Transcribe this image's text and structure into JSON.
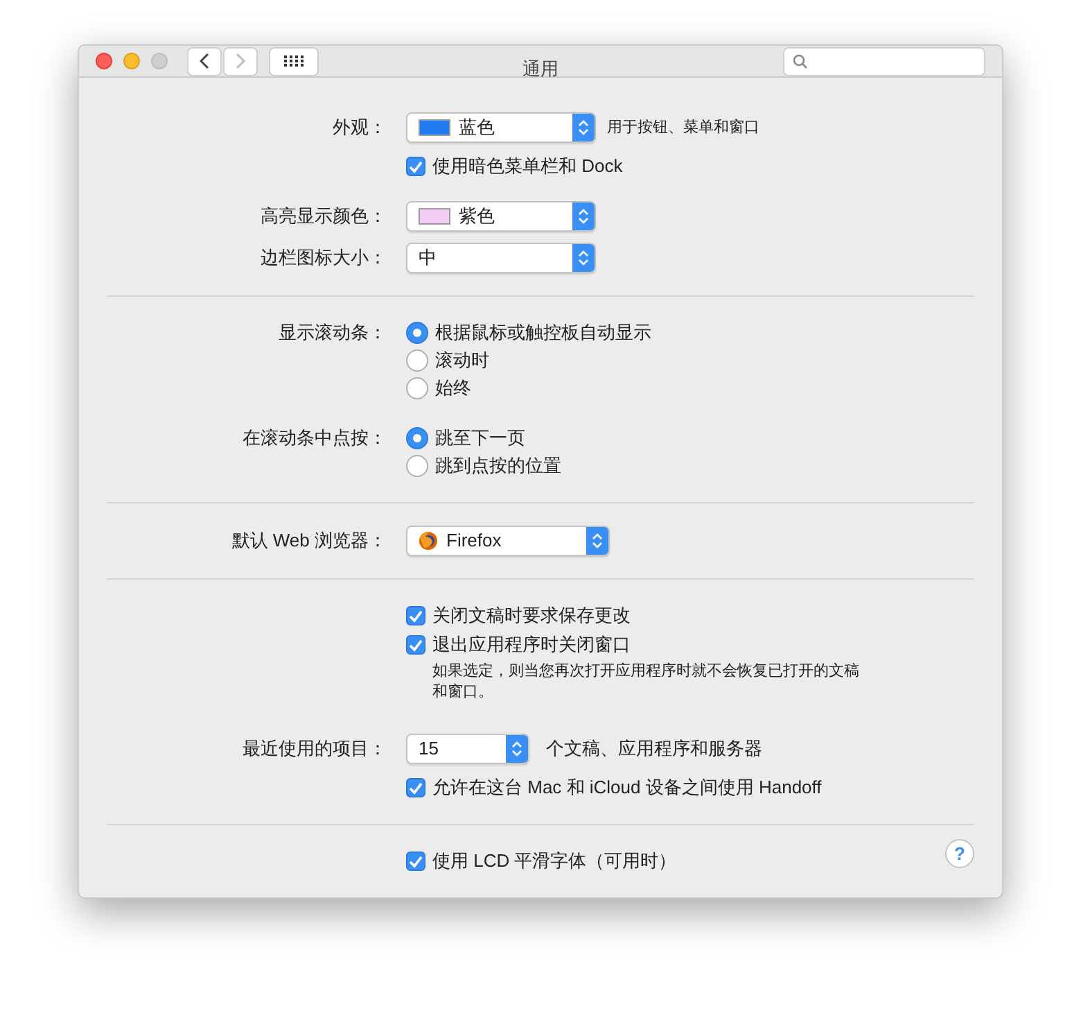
{
  "window": {
    "title": "通用"
  },
  "sections": [
    {
      "rows": [
        {
          "kind": "popup",
          "label": "外观：",
          "color": "#1f7cf0",
          "value": "蓝色",
          "note": "用于按钮、菜单和窗口"
        },
        {
          "kind": "checkbox",
          "text": "使用暗色菜单栏和 Dock",
          "checked": true
        },
        {
          "kind": "popup",
          "label": "高亮显示颜色：",
          "color": "#f3cdf5",
          "value": "紫色"
        },
        {
          "kind": "popup",
          "label": "边栏图标大小：",
          "value": "中"
        }
      ]
    },
    {
      "rows": [
        {
          "kind": "radio_group",
          "label": "显示滚动条：",
          "options": [
            {
              "text": "根据鼠标或触控板自动显示",
              "selected": true
            },
            {
              "text": "滚动时",
              "selected": false
            },
            {
              "text": "始终",
              "selected": false
            }
          ]
        },
        {
          "kind": "radio_group",
          "label": "在滚动条中点按：",
          "options": [
            {
              "text": "跳至下一页",
              "selected": true
            },
            {
              "text": "跳到点按的位置",
              "selected": false
            }
          ]
        }
      ]
    },
    {
      "rows": [
        {
          "kind": "browser_popup",
          "label": "默认 Web 浏览器：",
          "value": "Firefox"
        }
      ]
    },
    {
      "rows": [
        {
          "kind": "checkbox",
          "text": "关闭文稿时要求保存更改",
          "checked": true
        },
        {
          "kind": "checkbox",
          "text": "退出应用程序时关闭窗口",
          "checked": true
        },
        {
          "kind": "hint",
          "text": "如果选定，则当您再次打开应用程序时就不会恢复已打开的文稿和窗口。"
        },
        {
          "kind": "popup",
          "label": "最近使用的项目：",
          "value": "15",
          "note": "个文稿、应用程序和服务器"
        },
        {
          "kind": "checkbox",
          "text": "允许在这台 Mac 和 iCloud 设备之间使用 Handoff",
          "checked": true
        }
      ]
    },
    {
      "rows": [
        {
          "kind": "checkbox",
          "text": "使用 LCD 平滑字体（可用时）",
          "checked": true
        }
      ],
      "help": "?"
    }
  ]
}
